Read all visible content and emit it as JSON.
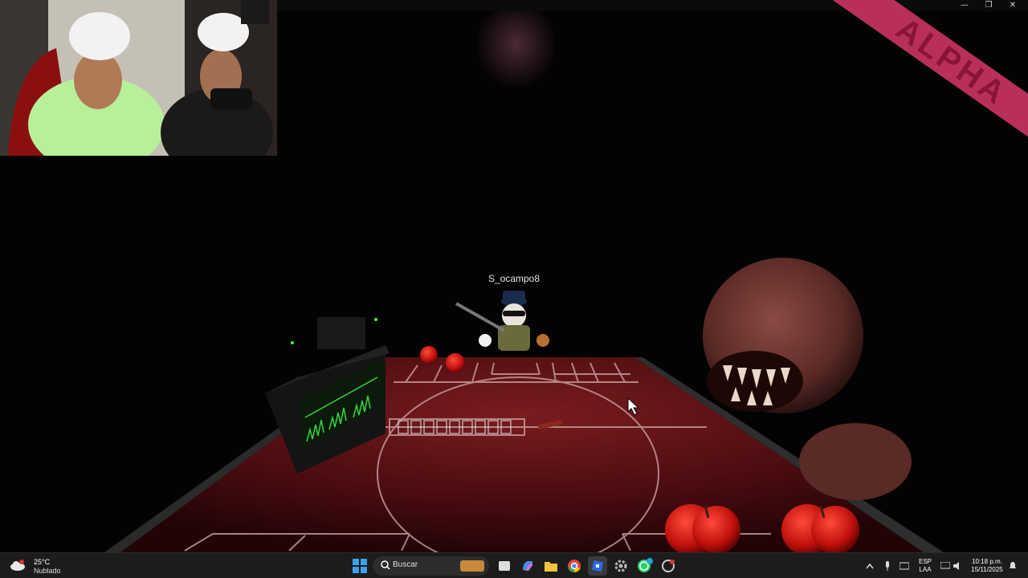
{
  "window": {
    "controls": {
      "minimize": "—",
      "maximize": "❐",
      "close": "✕"
    }
  },
  "overlay": {
    "alpha_label": "ALPHA"
  },
  "game": {
    "player_name": "S_ocampo8"
  },
  "taskbar": {
    "weather": {
      "temperature": "25°C",
      "condition": "Nublado"
    },
    "search_placeholder": "Buscar",
    "apps": [
      "start-icon",
      "search-icon",
      "widgets-icon",
      "file-explorer-icon",
      "copilot-icon",
      "folder-icon",
      "chrome-icon",
      "roblox-icon",
      "settings-icon",
      "whatsapp-icon",
      "roblox-studio-icon"
    ],
    "tray": {
      "language_top": "ESP",
      "language_bottom": "LAA",
      "time": "10:18 p.m.",
      "date": "15/11/2025"
    },
    "whatsapp_badge": "1"
  },
  "colors": {
    "taskbar_bg": "#1c1c1c",
    "alpha_ribbon": "#b8305a",
    "court": "#5a1014",
    "start_blue": "#3aa0f0"
  }
}
